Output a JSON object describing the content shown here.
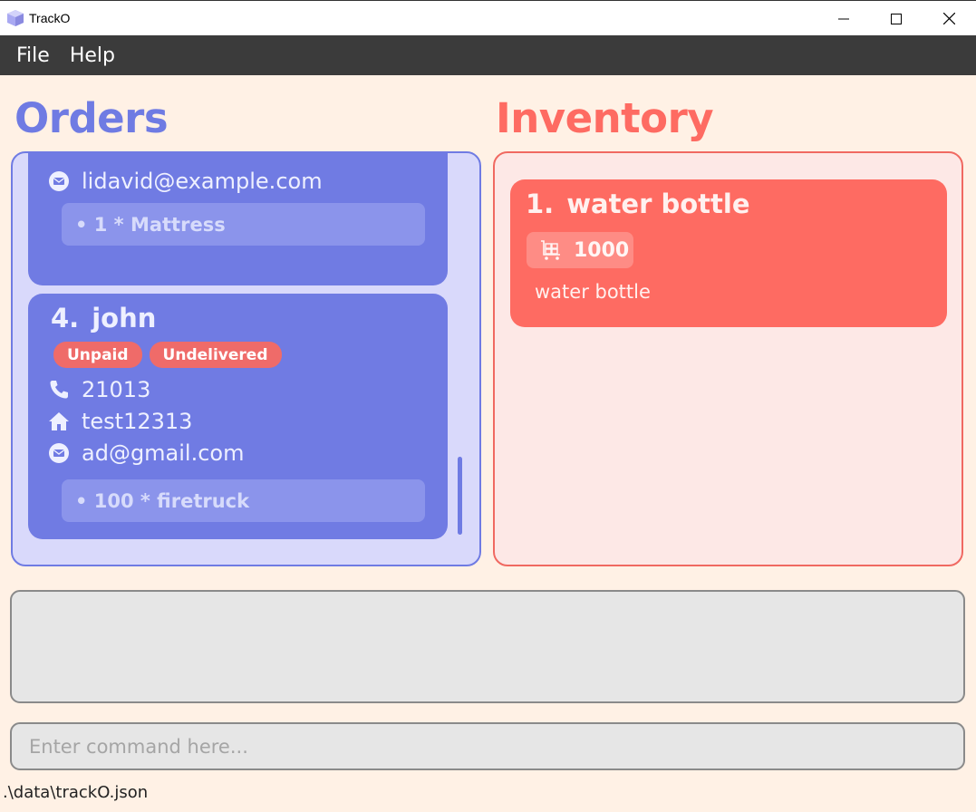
{
  "window": {
    "title": "TrackO",
    "app_icon": "cube-icon",
    "controls": [
      "minimize-icon",
      "maximize-icon",
      "close-icon"
    ]
  },
  "menu": {
    "items": [
      {
        "label": "File"
      },
      {
        "label": "Help"
      }
    ]
  },
  "orders": {
    "heading": "Orders",
    "accent_color": "#6f7be3",
    "cards": [
      {
        "email": "lidavid@example.com",
        "items": [
          "• 1 * Mattress"
        ]
      },
      {
        "index": "4.",
        "name": "john",
        "tags": [
          {
            "label": "Unpaid"
          },
          {
            "label": "Undelivered"
          }
        ],
        "phone": "21013",
        "address": "test12313",
        "email": "ad@gmail.com",
        "items": [
          "• 100 * firetruck"
        ]
      }
    ]
  },
  "inventory": {
    "heading": "Inventory",
    "accent_color": "#fe6b62",
    "items": [
      {
        "index": "1.",
        "name": "water bottle",
        "quantity": "1000",
        "quantity_icon": "cart-icon",
        "description": "water bottle"
      }
    ]
  },
  "result": {
    "text": ""
  },
  "command": {
    "value": "",
    "placeholder": "Enter command here..."
  },
  "status": {
    "file_path": ".\\data\\trackO.json"
  }
}
